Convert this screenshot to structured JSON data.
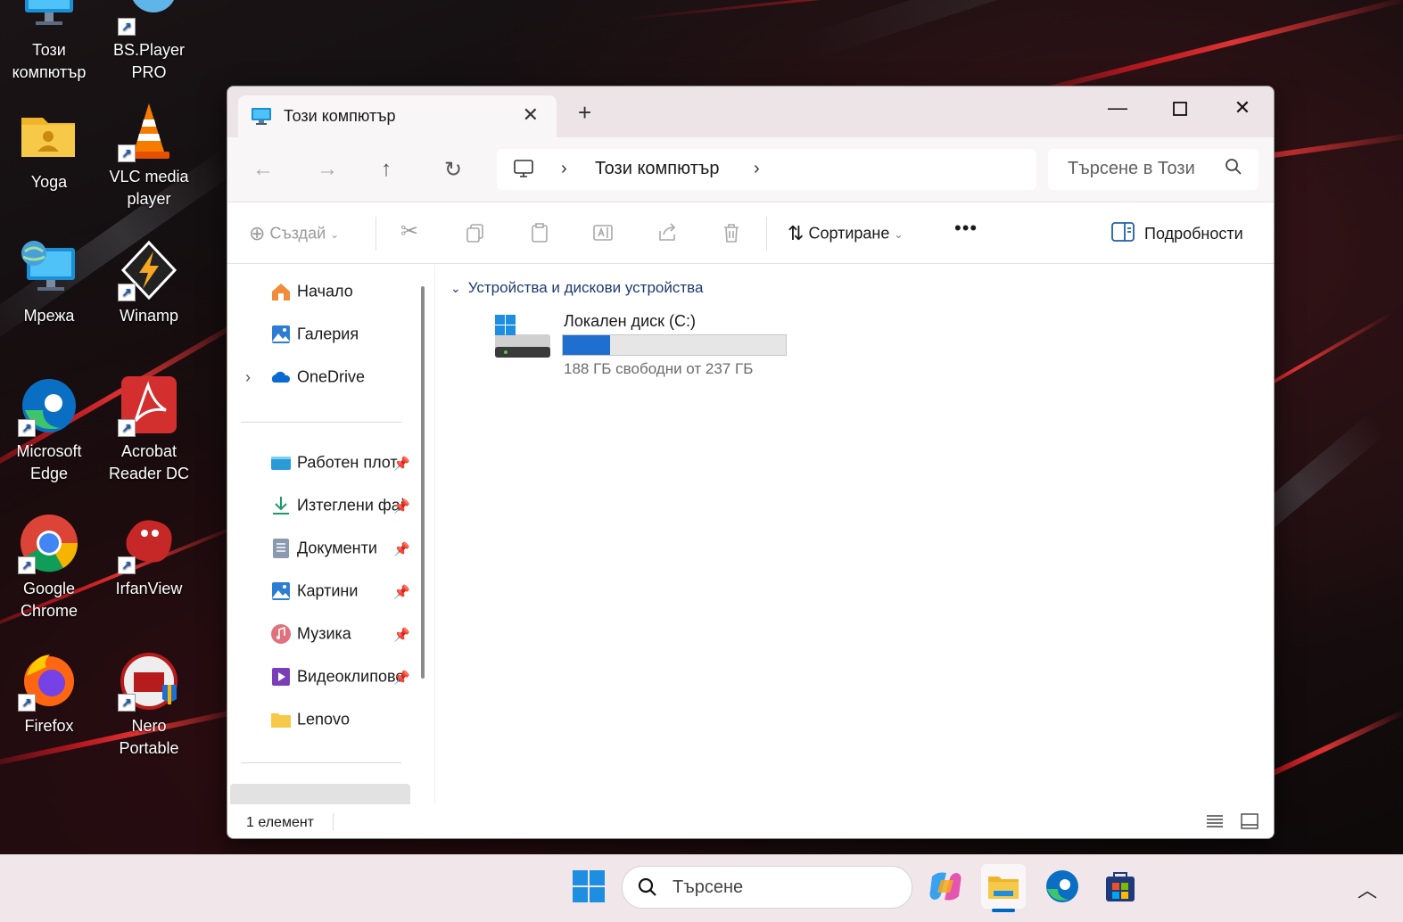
{
  "desktop": {
    "icons": [
      {
        "label": "Този компютър",
        "name": "this-pc-desktop-icon"
      },
      {
        "label": "BS.Player PRO",
        "name": "bsplayer-desktop-icon"
      },
      {
        "label": "Yoga",
        "name": "yoga-desktop-icon"
      },
      {
        "label": "VLC media player",
        "name": "vlc-desktop-icon"
      },
      {
        "label": "Мрежа",
        "name": "network-desktop-icon"
      },
      {
        "label": "Winamp",
        "name": "winamp-desktop-icon"
      },
      {
        "label": "Microsoft Edge",
        "name": "edge-desktop-icon"
      },
      {
        "label": "Acrobat Reader DC",
        "name": "acrobat-desktop-icon"
      },
      {
        "label": "Google Chrome",
        "name": "chrome-desktop-icon"
      },
      {
        "label": "IrfanView",
        "name": "irfanview-desktop-icon"
      },
      {
        "label": "Firefox",
        "name": "firefox-desktop-icon"
      },
      {
        "label": "Nero Portable",
        "name": "nero-desktop-icon"
      }
    ]
  },
  "explorer": {
    "tab_title": "Този компютър",
    "address": {
      "crumb": "Този компютър"
    },
    "search_placeholder": "Търсене в Този",
    "toolbar": {
      "create": "Създай",
      "sort": "Сортиране",
      "details": "Подробности"
    },
    "sidebar": {
      "top": [
        "Начало",
        "Галерия",
        "OneDrive"
      ],
      "pinned": [
        "Работен плот",
        "Изтеглени файлове",
        "Документи",
        "Картини",
        "Музика",
        "Видеоклипове",
        "Lenovo"
      ]
    },
    "group_title": "Устройства и дискови устройства",
    "drive": {
      "name": "Локален диск (C:)",
      "free_text": "188 ГБ свободни от 237 ГБ",
      "used_fraction": 0.21
    },
    "status": {
      "count": "1 елемент"
    }
  },
  "taskbar": {
    "search_placeholder": "Търсене"
  },
  "colors": {
    "accent": "#0067c0",
    "drive_bar": "#1e6fd0"
  }
}
